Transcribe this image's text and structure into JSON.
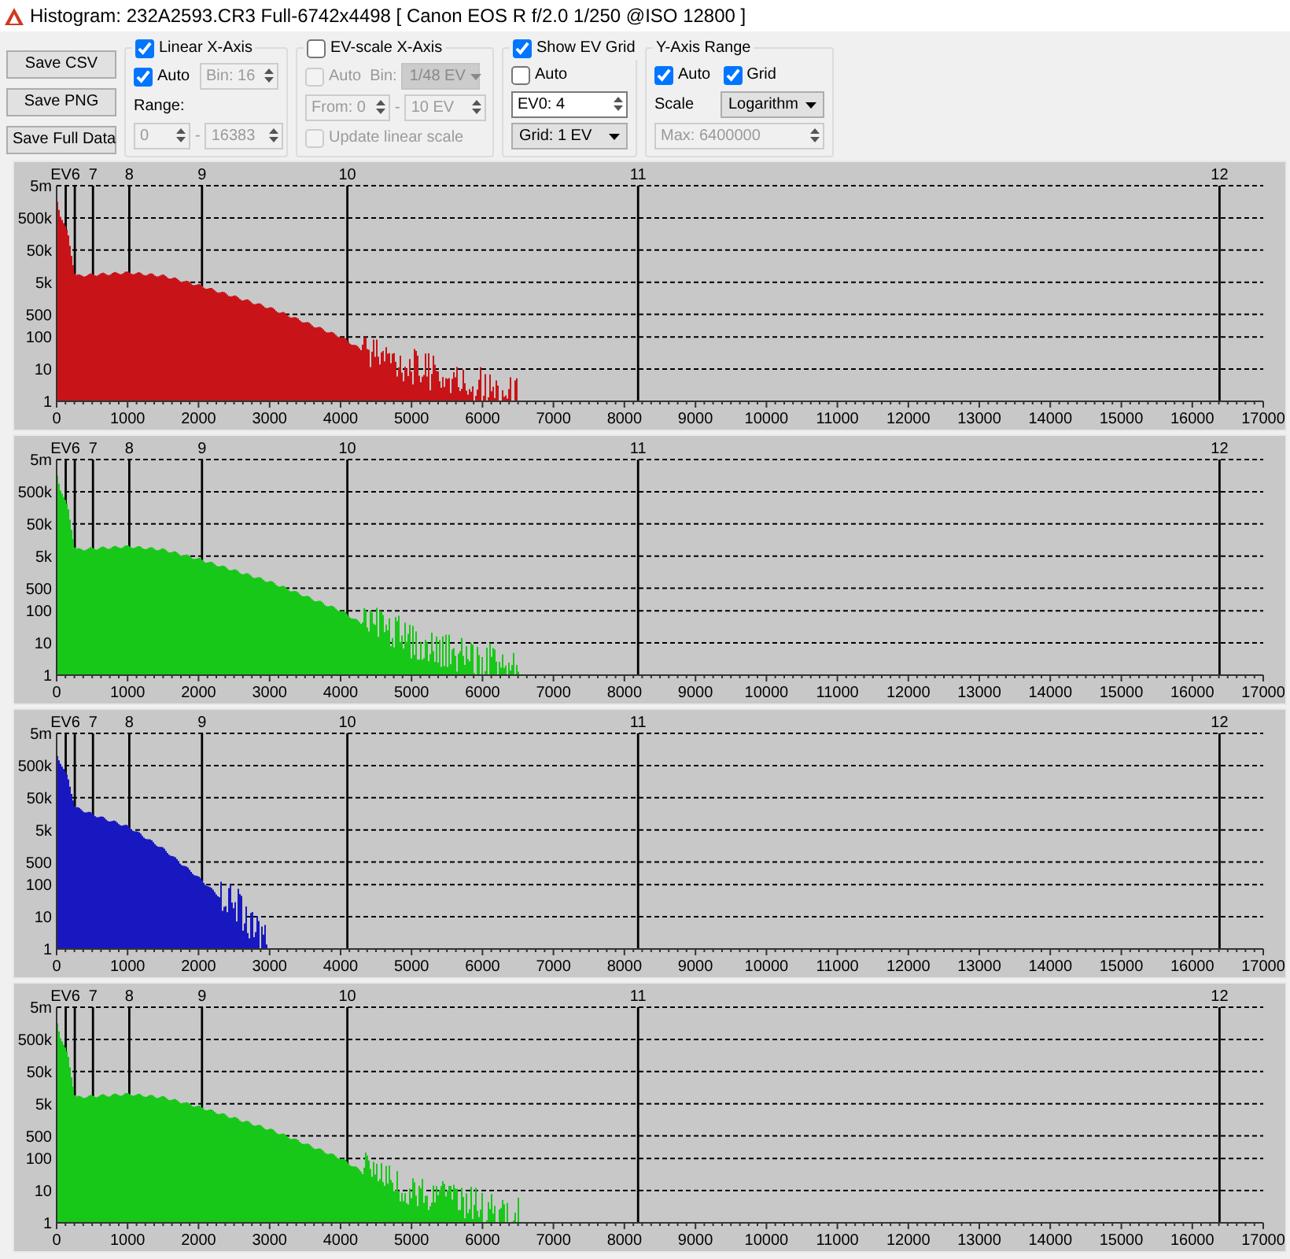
{
  "window": {
    "title": "Histogram: 232A2593.CR3 Full-6742x4498 [ Canon EOS R f/2.0 1/250 @ISO 12800 ]"
  },
  "buttons": [
    "Save CSV",
    "Save PNG",
    "Save Full Data"
  ],
  "linear_x_axis": {
    "label": "Linear X-Axis",
    "checked": true,
    "auto": {
      "label": "Auto",
      "checked": true,
      "disabled": false
    },
    "bin": {
      "value": "Bin: 16",
      "disabled": true
    },
    "range_label": "Range:",
    "range_from": {
      "value": "0",
      "disabled": true
    },
    "range_separator": "-",
    "range_to": {
      "value": "16383",
      "disabled": true
    }
  },
  "ev_scale_x_axis": {
    "label": "EV-scale X-Axis",
    "checked": false,
    "auto": {
      "label": "Auto",
      "checked": false,
      "disabled": true
    },
    "bin_label": "Bin:",
    "bin": {
      "value": "1/48 EV",
      "disabled": true
    },
    "from": {
      "value": "From: 0",
      "disabled": true
    },
    "separator": "-",
    "to": {
      "value": "10 EV",
      "disabled": true
    },
    "update": {
      "label": "Update linear scale",
      "checked": false,
      "disabled": true
    }
  },
  "show_ev_grid": {
    "label": "Show EV Grid",
    "checked": true,
    "auto": {
      "label": "Auto",
      "checked": false,
      "disabled": false
    },
    "ev0": {
      "value": "EV0: 4",
      "disabled": false
    },
    "grid": {
      "value": "Grid: 1 EV",
      "disabled": false
    }
  },
  "y_axis_range": {
    "label": "Y-Axis Range",
    "auto": {
      "label": "Auto",
      "checked": true,
      "disabled": false
    },
    "grid": {
      "label": "Grid",
      "checked": true,
      "disabled": false
    },
    "scale_label": "Scale",
    "scale": {
      "value": "Logarithm",
      "disabled": false
    },
    "max": {
      "value": "Max: 6400000",
      "disabled": true
    }
  },
  "panels": [
    {
      "color": "#c81418",
      "kind": "wide",
      "ev_labels": [
        "EV6",
        "7",
        "8",
        "9",
        "10",
        "11",
        "12"
      ],
      "y_labels": [
        "5m",
        "500k",
        "50k",
        "5k",
        "500",
        "100",
        "10",
        "1"
      ],
      "x_labels": [
        "0",
        "1000",
        "2000",
        "3000",
        "4000",
        "5000",
        "6000",
        "7000",
        "8000",
        "9000",
        "10000",
        "11000",
        "12000",
        "13000",
        "14000",
        "15000",
        "16000",
        "17000"
      ]
    },
    {
      "color": "#18c818",
      "kind": "wide",
      "ev_labels": [
        "EV6",
        "7",
        "8",
        "9",
        "10",
        "11",
        "12"
      ],
      "y_labels": [
        "5m",
        "500k",
        "50k",
        "5k",
        "500",
        "100",
        "10",
        "1"
      ],
      "x_labels": [
        "0",
        "1000",
        "2000",
        "3000",
        "4000",
        "5000",
        "6000",
        "7000",
        "8000",
        "9000",
        "10000",
        "11000",
        "12000",
        "13000",
        "14000",
        "15000",
        "16000",
        "17000"
      ]
    },
    {
      "color": "#1818c0",
      "kind": "narrow",
      "ev_labels": [
        "EV6",
        "7",
        "8",
        "9",
        "10",
        "11",
        "12"
      ],
      "y_labels": [
        "5m",
        "500k",
        "50k",
        "5k",
        "500",
        "100",
        "10",
        "1"
      ],
      "x_labels": [
        "0",
        "1000",
        "2000",
        "3000",
        "4000",
        "5000",
        "6000",
        "7000",
        "8000",
        "9000",
        "10000",
        "11000",
        "12000",
        "13000",
        "14000",
        "15000",
        "16000",
        "17000"
      ]
    },
    {
      "color": "#18c818",
      "kind": "wide",
      "ev_labels": [
        "EV6",
        "7",
        "8",
        "9",
        "10",
        "11",
        "12"
      ],
      "y_labels": [
        "5m",
        "500k",
        "50k",
        "5k",
        "500",
        "100",
        "10",
        "1"
      ],
      "x_labels": [
        "0",
        "1000",
        "2000",
        "3000",
        "4000",
        "5000",
        "6000",
        "7000",
        "8000",
        "9000",
        "10000",
        "11000",
        "12000",
        "13000",
        "14000",
        "15000",
        "16000",
        "17000"
      ]
    }
  ]
}
